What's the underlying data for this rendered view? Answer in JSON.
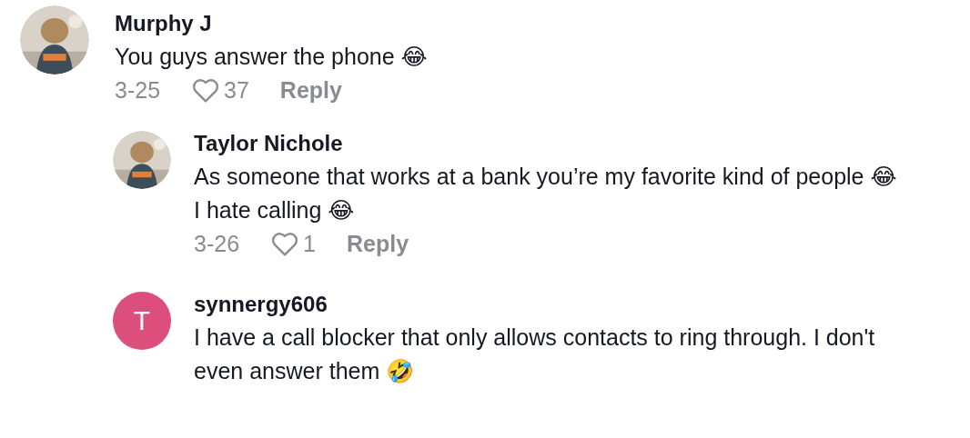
{
  "comments": [
    {
      "author": "Murphy J",
      "text": "You guys answer the phone 😂",
      "date": "3-25",
      "likes": "37",
      "reply_label": "Reply",
      "replies": [
        {
          "author": "Taylor Nichole",
          "text": "As someone that works at a bank you’re my favorite kind of people 😂 I hate calling 😂",
          "date": "3-26",
          "likes": "1",
          "reply_label": "Reply"
        },
        {
          "author": "synnergy606",
          "text": "I have a call blocker that only allows contacts to ring through. I don't even answer them 🤣",
          "avatar": {
            "kind": "letter",
            "letter": "T",
            "color": "#dc4f7c"
          }
        }
      ]
    }
  ]
}
